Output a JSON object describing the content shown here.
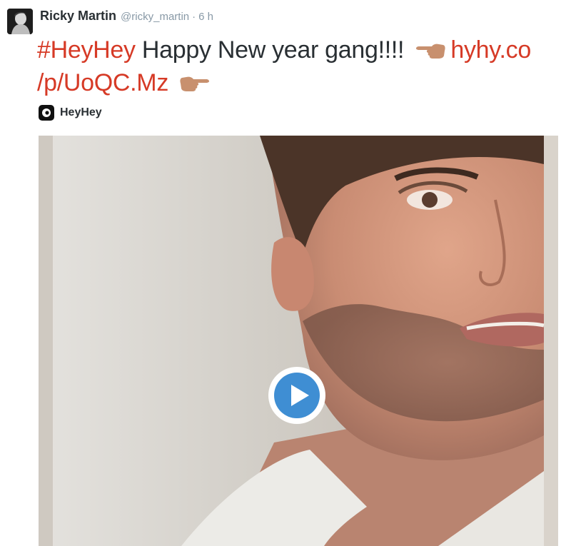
{
  "tweet": {
    "display_name": "Ricky Martin",
    "handle": "@ricky_martin",
    "separator": "·",
    "timestamp": "6 h",
    "text": {
      "hashtag": "#HeyHey",
      "body": "Happy New year gang!!!!",
      "link_line1": "hyhy.co",
      "link_line2": "/p/UoQC.Mz"
    },
    "hands": [
      "backhand-index-pointing-left-icon",
      "backhand-index-pointing-right-icon"
    ]
  },
  "card": {
    "source_name": "HeyHey",
    "source_icon": "heyhey-logo-icon",
    "media_type": "video",
    "play_icon": "play-icon"
  },
  "colors": {
    "link": "#d63a26",
    "text": "#292f33",
    "meta": "#8899a6",
    "play_ring": "#ffffff",
    "play_fill": "#3f8ed3"
  }
}
